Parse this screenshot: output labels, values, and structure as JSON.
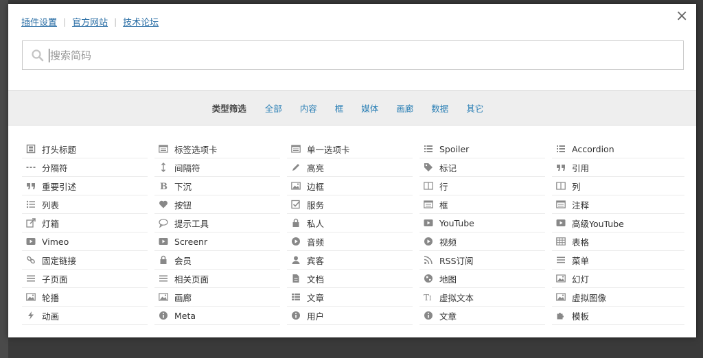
{
  "header": {
    "links": [
      "插件设置",
      "官方网站",
      "技术论坛"
    ],
    "close_symbol": "×"
  },
  "search": {
    "placeholder": "搜索简码"
  },
  "filter": {
    "label": "类型筛选",
    "items": [
      "全部",
      "内容",
      "框",
      "媒体",
      "画廊",
      "数据",
      "其它"
    ]
  },
  "shortcodes": [
    {
      "label": "打头标题",
      "icon": "heading-icon"
    },
    {
      "label": "标签选项卡",
      "icon": "tabs-icon"
    },
    {
      "label": "单一选项卡",
      "icon": "tab-icon"
    },
    {
      "label": "Spoiler",
      "icon": "list-icon"
    },
    {
      "label": "Accordion",
      "icon": "list-icon"
    },
    {
      "label": "分隔符",
      "icon": "divider-icon"
    },
    {
      "label": "间隔符",
      "icon": "spacer-icon"
    },
    {
      "label": "高亮",
      "icon": "pencil-icon"
    },
    {
      "label": "标记",
      "icon": "tag-icon"
    },
    {
      "label": "引用",
      "icon": "quote-icon"
    },
    {
      "label": "重要引述",
      "icon": "quote-icon"
    },
    {
      "label": "下沉",
      "icon": "bold-icon"
    },
    {
      "label": "边框",
      "icon": "image-icon"
    },
    {
      "label": "行",
      "icon": "columns-icon"
    },
    {
      "label": "列",
      "icon": "columns-icon"
    },
    {
      "label": "列表",
      "icon": "list-ul-icon"
    },
    {
      "label": "按钮",
      "icon": "heart-icon"
    },
    {
      "label": "服务",
      "icon": "check-square-icon"
    },
    {
      "label": "框",
      "icon": "tabs-icon"
    },
    {
      "label": "注释",
      "icon": "tabs-icon"
    },
    {
      "label": "灯箱",
      "icon": "external-link-icon"
    },
    {
      "label": "提示工具",
      "icon": "comment-icon"
    },
    {
      "label": "私人",
      "icon": "lock-icon"
    },
    {
      "label": "YouTube",
      "icon": "play-square-icon"
    },
    {
      "label": "高级YouTube",
      "icon": "play-square-icon"
    },
    {
      "label": "Vimeo",
      "icon": "play-square-icon"
    },
    {
      "label": "Screenr",
      "icon": "play-square-icon"
    },
    {
      "label": "音频",
      "icon": "play-circle-icon"
    },
    {
      "label": "视频",
      "icon": "play-circle-icon"
    },
    {
      "label": "表格",
      "icon": "table-icon"
    },
    {
      "label": "固定链接",
      "icon": "link-icon"
    },
    {
      "label": "会员",
      "icon": "lock-icon"
    },
    {
      "label": "宾客",
      "icon": "user-icon"
    },
    {
      "label": "RSS订阅",
      "icon": "rss-icon"
    },
    {
      "label": "菜单",
      "icon": "bars-icon"
    },
    {
      "label": "子页面",
      "icon": "bars-icon"
    },
    {
      "label": "相关页面",
      "icon": "bars-icon"
    },
    {
      "label": "文档",
      "icon": "file-icon"
    },
    {
      "label": "地图",
      "icon": "globe-icon"
    },
    {
      "label": "幻灯",
      "icon": "image-icon"
    },
    {
      "label": "轮播",
      "icon": "image-icon"
    },
    {
      "label": "画廊",
      "icon": "image-icon"
    },
    {
      "label": "文章",
      "icon": "th-list-icon"
    },
    {
      "label": "虚拟文本",
      "icon": "text-height-icon"
    },
    {
      "label": "虚拟图像",
      "icon": "image-icon"
    },
    {
      "label": "动画",
      "icon": "bolt-icon"
    },
    {
      "label": "Meta",
      "icon": "info-icon"
    },
    {
      "label": "用户",
      "icon": "info-icon"
    },
    {
      "label": "文章",
      "icon": "info-icon"
    },
    {
      "label": "模板",
      "icon": "puzzle-icon"
    }
  ],
  "colors": {
    "link": "#2a6ea5",
    "filter_link": "#2a7fb5",
    "icon": "#888888"
  }
}
